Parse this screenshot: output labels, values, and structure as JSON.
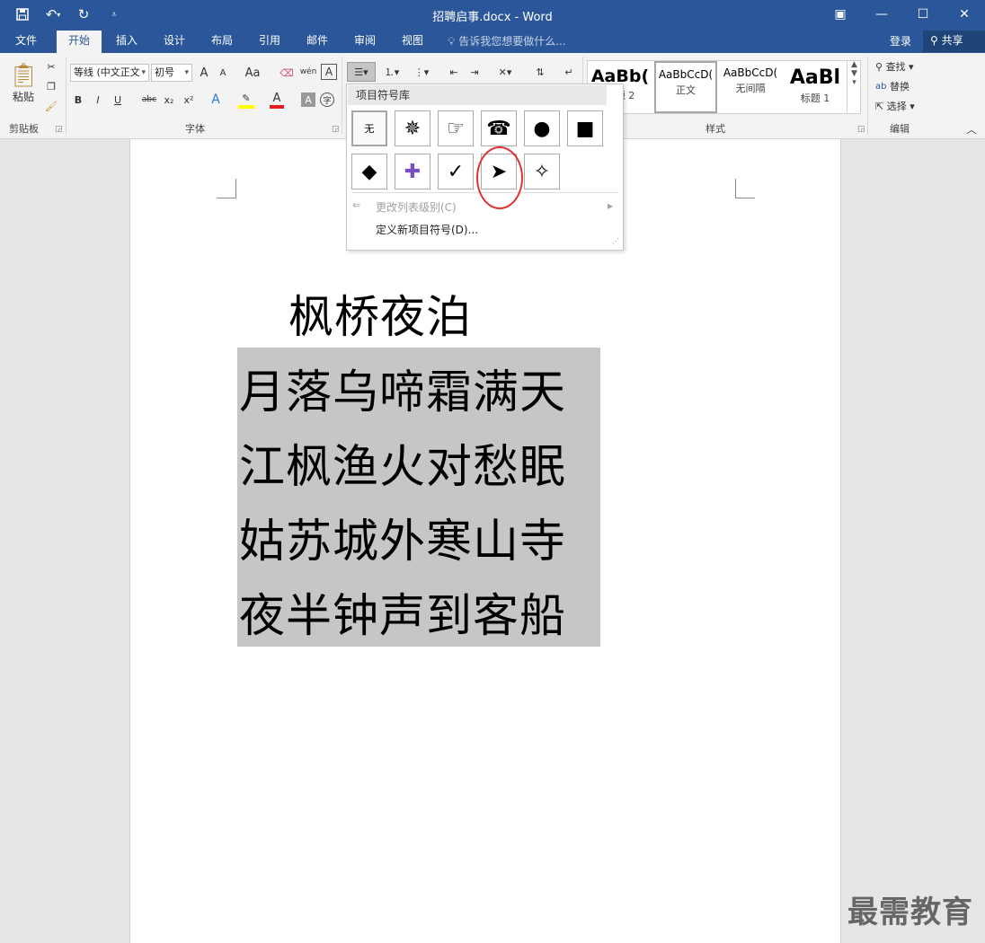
{
  "title_bar": {
    "document_title": "招聘启事.docx - Word",
    "quick_access": {
      "save_icon": "save-icon",
      "undo_icon": "undo-icon",
      "redo_icon": "redo-icon",
      "customize_icon": "customize-qat-icon"
    },
    "window_controls": {
      "ribbon_options": "▣",
      "minimize": "—",
      "maximize": "☐",
      "close": "✕"
    }
  },
  "tabs": [
    {
      "label": "文件"
    },
    {
      "label": "开始"
    },
    {
      "label": "插入"
    },
    {
      "label": "设计"
    },
    {
      "label": "布局"
    },
    {
      "label": "引用"
    },
    {
      "label": "邮件"
    },
    {
      "label": "审阅"
    },
    {
      "label": "视图"
    }
  ],
  "tell_me": {
    "placeholder": "告诉我您想要做什么..."
  },
  "account": {
    "login": "登录",
    "share": "共享"
  },
  "ribbon": {
    "clipboard": {
      "paste": "粘贴",
      "group_label": "剪贴板"
    },
    "font": {
      "font_name": "等线 (中文正文",
      "font_size": "初号",
      "group_label": "字体",
      "bold": "B",
      "italic": "I",
      "underline": "U",
      "strike": "abc",
      "subscript": "x₂",
      "superscript": "x²",
      "grow": "A",
      "shrink": "A",
      "case": "Aa",
      "phonetic": "wén",
      "border_char": "A",
      "font_color": "A",
      "shading_char": "A",
      "enclose_char": "字"
    },
    "styles": {
      "group_label": "样式",
      "items": [
        {
          "preview": "AaBb(",
          "name": "标题 2"
        },
        {
          "preview": "AaBbCcD(",
          "name": "正文"
        },
        {
          "preview": "AaBbCcD(",
          "name": "无间隔"
        },
        {
          "preview": "AaBl",
          "name": "标题 1"
        }
      ]
    },
    "editing": {
      "group_label": "编辑",
      "find": "查找",
      "replace": "替换",
      "select": "选择"
    }
  },
  "bullet_gallery": {
    "header": "项目符号库",
    "row1": [
      {
        "symbol": "无",
        "icon": "none"
      },
      {
        "symbol": "✵",
        "icon": "starburst-bullet-icon"
      },
      {
        "symbol": "☞",
        "icon": "pointing-hand-bullet-icon"
      },
      {
        "symbol": "☎",
        "icon": "telephone-bullet-icon"
      },
      {
        "symbol": "●",
        "icon": "filled-circle-bullet-icon"
      },
      {
        "symbol": "■",
        "icon": "filled-square-bullet-icon"
      }
    ],
    "row2": [
      {
        "symbol": "◆",
        "icon": "filled-diamond-bullet-icon"
      },
      {
        "symbol": "✚",
        "icon": "cross-bullet-icon"
      },
      {
        "symbol": "✓",
        "icon": "checkmark-bullet-icon"
      },
      {
        "symbol": "➤",
        "icon": "arrowhead-bullet-icon"
      },
      {
        "symbol": "✧",
        "icon": "four-point-star-bullet-icon"
      }
    ],
    "change_level": "更改列表级别(C)",
    "define_new": "定义新项目符号(D)..."
  },
  "document": {
    "heading": "枫桥夜泊",
    "lines": [
      "月落乌啼霜满天",
      "江枫渔火对愁眠",
      "姑苏城外寒山寺",
      "夜半钟声到客船"
    ]
  },
  "watermark": "最需教育",
  "colors": {
    "accent": "#2b579a",
    "selection": "#c6c6c6",
    "highlight_circle": "#e03030"
  }
}
